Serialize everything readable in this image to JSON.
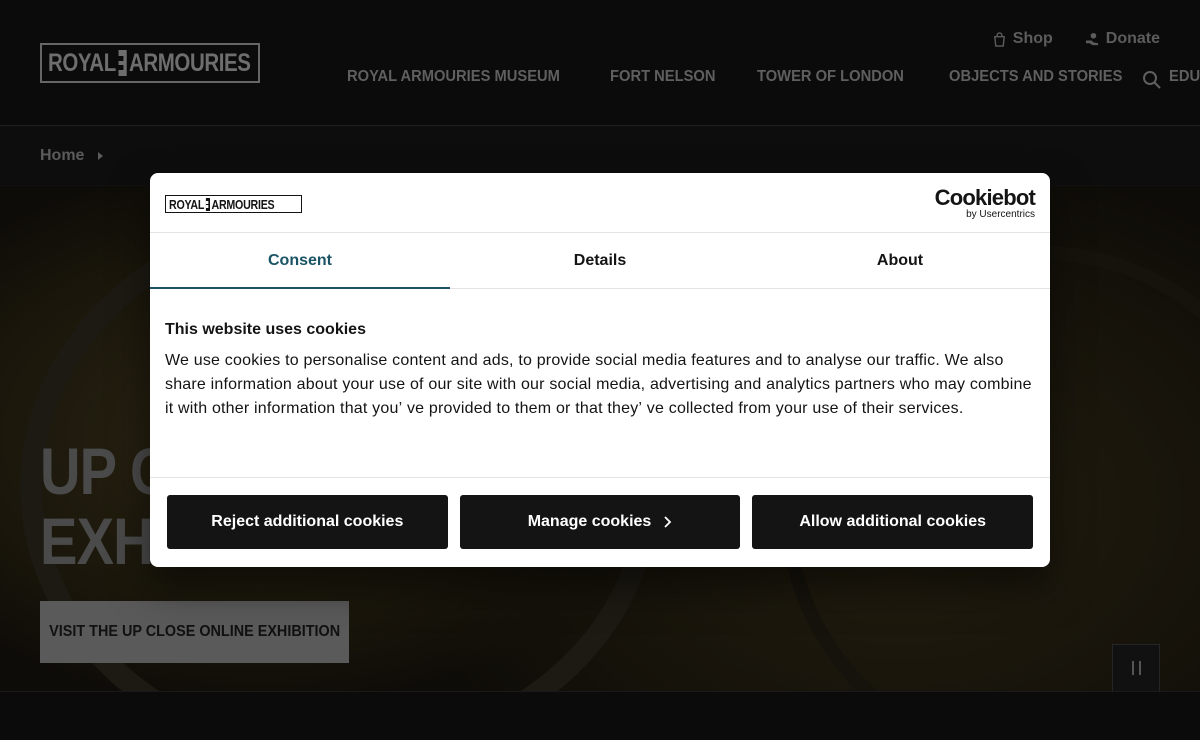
{
  "header": {
    "logo": {
      "left": "ROYAL",
      "right": "ARMOURIES"
    },
    "utility": [
      {
        "label": "Shop",
        "icon": "shopping-bag-icon"
      },
      {
        "label": "Donate",
        "icon": "donate-hand-icon"
      }
    ],
    "nav": [
      "ROYAL ARMOURIES MUSEUM",
      "FORT NELSON",
      "TOWER OF LONDON",
      "OBJECTS AND STORIES",
      "EDUCATION"
    ]
  },
  "breadcrumb": {
    "home": "Home"
  },
  "hero": {
    "title_line1": "UP C",
    "title_line2": "EXH",
    "cta": "VISIT THE UP CLOSE ONLINE EXHIBITION"
  },
  "cookie_dialog": {
    "logo": {
      "left": "ROYAL",
      "right": "ARMOURIES"
    },
    "brand": "Cookiebot",
    "brand_sub": "by Usercentrics",
    "tabs": [
      "Consent",
      "Details",
      "About"
    ],
    "active_tab": "Consent",
    "heading": "This website uses cookies",
    "body": "We use cookies to personalise content and ads, to provide social media features and to analyse our traffic. We also share information about your use of our site with our social media, advertising and analytics partners who may combine it with other information that you’ ve provided to them or that they’ ve collected from your use of their services.",
    "buttons": {
      "reject": "Reject additional cookies",
      "manage": "Manage cookies",
      "allow": "Allow additional cookies"
    }
  },
  "colors": {
    "accent_tab": "#1a5465",
    "button_bg": "#141414",
    "header_text": "#5f5f5f"
  }
}
